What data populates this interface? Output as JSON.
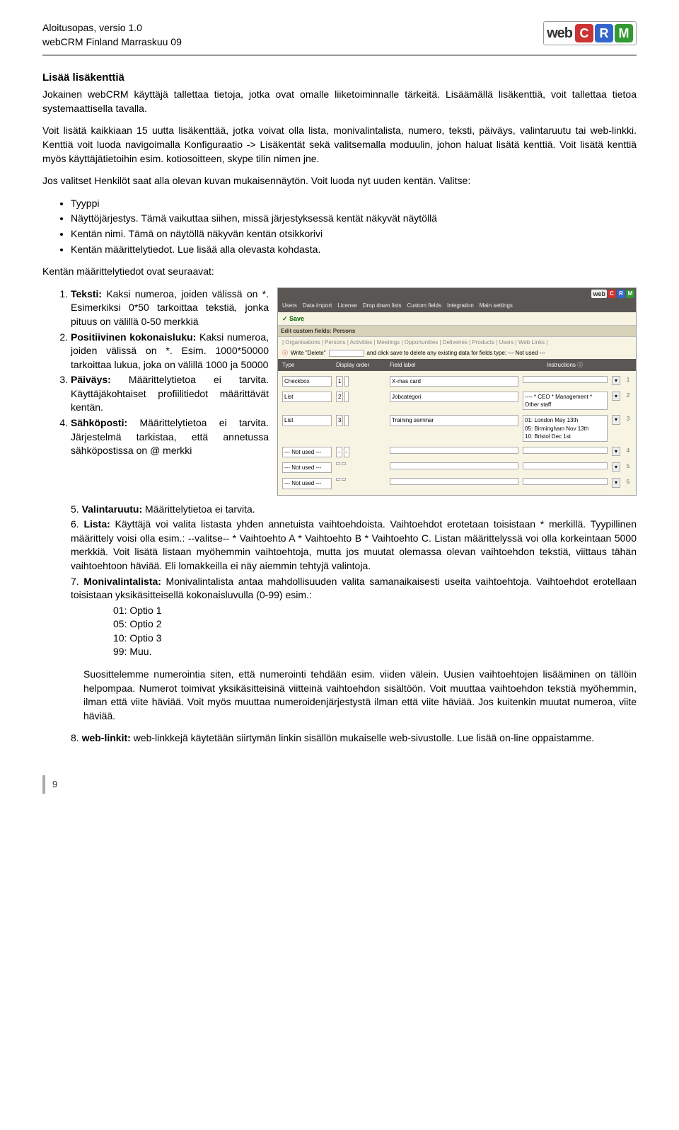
{
  "header": {
    "line1": "Aloitusopas, versio 1.0",
    "line2": "webCRM Finland Marraskuu 09",
    "logo_web": "web",
    "logo_c": "C",
    "logo_r": "R",
    "logo_m": "M"
  },
  "section_title": "Lisää lisäkenttiä",
  "para1": "Jokainen webCRM käyttäjä tallettaa tietoja, jotka ovat omalle liiketoiminnalle tärkeitä. Lisäämällä lisäkenttiä, voit tallettaa tietoa systemaattisella tavalla.",
  "para2": "Voit lisätä kaikkiaan 15 uutta lisäkenttää, jotka voivat olla lista, monivalintalista, numero, teksti, päiväys, valintaruutu tai web-linkki. Kenttiä voit luoda navigoimalla Konfiguraatio -> Lisäkentät sekä valitsemalla moduulin, johon haluat lisätä kenttiä. Voit lisätä kenttiä myös käyttäjätietoihin esim. kotiosoitteen, skype tilin nimen jne.",
  "para3": "Jos valitset Henkilöt saat alla olevan kuvan mukaisennäytön. Voit luoda nyt uuden kentän. Valitse:",
  "bullets": [
    "Tyyppi",
    "Näyttöjärjestys. Tämä vaikuttaa siihen, missä järjestyksessä kentät näkyvät näytöllä",
    "Kentän nimi. Tämä on näytöllä näkyvän kentän otsikkorivi",
    "Kentän määrittelytiedot. Lue lisää alla olevasta kohdasta."
  ],
  "para4": "Kentän määrittelytiedot ovat seuraavat:",
  "ol1": [
    {
      "b": "Teksti:",
      "t": " Kaksi numeroa, joiden välissä on *. Esimerkiksi 0*50 tarkoittaa tekstiä, jonka pituus on välillä 0-50 merkkiä"
    },
    {
      "b": "Positiivinen kokonaisluku:",
      "t": " Kaksi numeroa, joiden välissä on *. Esim. 1000*50000 tarkoittaa lukua, joka on välillä 1000 ja 50000"
    },
    {
      "b": "Päiväys:",
      "t": " Määrittelytietoa ei tarvita. Käyttäjäkohtaiset profiilitiedot määrittävät kentän."
    },
    {
      "b": "Sähköposti:",
      "t": " Määrittelytietoa ei tarvita. Järjestelmä tarkistaa, että annetussa sähköpostissa on @ merkki"
    }
  ],
  "ol2": [
    {
      "b": "Valintaruutu:",
      "t": " Määrittelytietoa ei tarvita."
    },
    {
      "b": "Lista:",
      "t": " Käyttäjä voi valita listasta yhden annetuista vaihtoehdoista. Vaihtoehdot erotetaan toisistaan * merkillä. Tyypillinen määrittely voisi olla esim.:   --valitse-- * Vaihtoehto A * Vaihtoehto B * Vaihtoehto C. Listan määrittelyssä voi olla korkeintaan 5000 merkkiä. Voit lisätä listaan myöhemmin vaihtoehtoja, mutta jos muutat olemassa olevan vaihtoehdon tekstiä, viittaus tähän vaihtoehtoon häviää. Eli lomakkeilla ei näy aiemmin tehtyjä valintoja."
    },
    {
      "b": "Monivalintalista:",
      "t": " Monivalintalista antaa mahdollisuuden valita samanaikaisesti useita vaihtoehtoja. Vaihtoehdot erotellaan toisistaan yksikäsitteisellä kokonaisluvulla (0-99) esim.:"
    }
  ],
  "options_block": [
    "01: Optio 1",
    "05: Optio 2",
    "10: Optio 3",
    "99: Muu."
  ],
  "para_suos": "Suosittelemme numerointia siten, että numerointi tehdään esim. viiden välein. Uusien vaihtoehtojen lisääminen on tällöin helpompaa. Numerot toimivat yksikäsitteisinä viitteinä vaihtoehdon sisältöön. Voit muuttaa vaihtoehdon tekstiä myöhemmin, ilman että viite häviää. Voit myös muuttaa numeroidenjärjestystä ilman että viite häviää. Jos kuitenkin muutat numeroa, viite häviää.",
  "ol3": [
    {
      "b": "web-linkit:",
      "t": " web-linkkejä käytetään siirtymän linkin sisällön mukaiselle web-sivustolle. Lue lisää on-line oppaistamme."
    }
  ],
  "screenshot": {
    "nav": [
      "Users",
      "Data import",
      "License",
      "Drop down lists",
      "Custom fields",
      "Integration",
      "Main settings"
    ],
    "save": "✓ Save",
    "bar": "Edit custom fields: Persons",
    "tabs": "| Organisations | Persons | Activities | Meetings | Opportunities | Deliveries | Products | Users | Web Links |",
    "write_lead": "Write \"Delete\"",
    "write_rest": "and click save to delete any existing data for fields type: --- Not used ---",
    "thead": [
      "Type",
      "Display order",
      "Field label",
      "Instructions ⓘ"
    ],
    "rows": [
      {
        "type": "Checkbox",
        "d1": "1",
        "d2": "",
        "label": "X-mas card",
        "instr": "",
        "idx": "1"
      },
      {
        "type": "List",
        "d1": "2",
        "d2": "",
        "label": "Jobcategori",
        "instr": "---- * CEO * Management * Other staff",
        "idx": "2"
      },
      {
        "type": "List",
        "d1": "3",
        "d2": "",
        "label": "Training seminar",
        "instr": "01: London May 13th\n05: Birmingham Nov 13th\n10: Bristol Dec 1st",
        "idx": "3"
      },
      {
        "type": "--- Not used ---",
        "d1": "-",
        "d2": "-",
        "label": "",
        "instr": "",
        "idx": "4"
      },
      {
        "type": "--- Not used ---",
        "d1": "",
        "d2": "",
        "label": "",
        "instr": "",
        "idx": "5"
      },
      {
        "type": "--- Not used ---",
        "d1": "",
        "d2": "",
        "label": "",
        "instr": "",
        "idx": "6"
      }
    ]
  },
  "page_number": "9"
}
